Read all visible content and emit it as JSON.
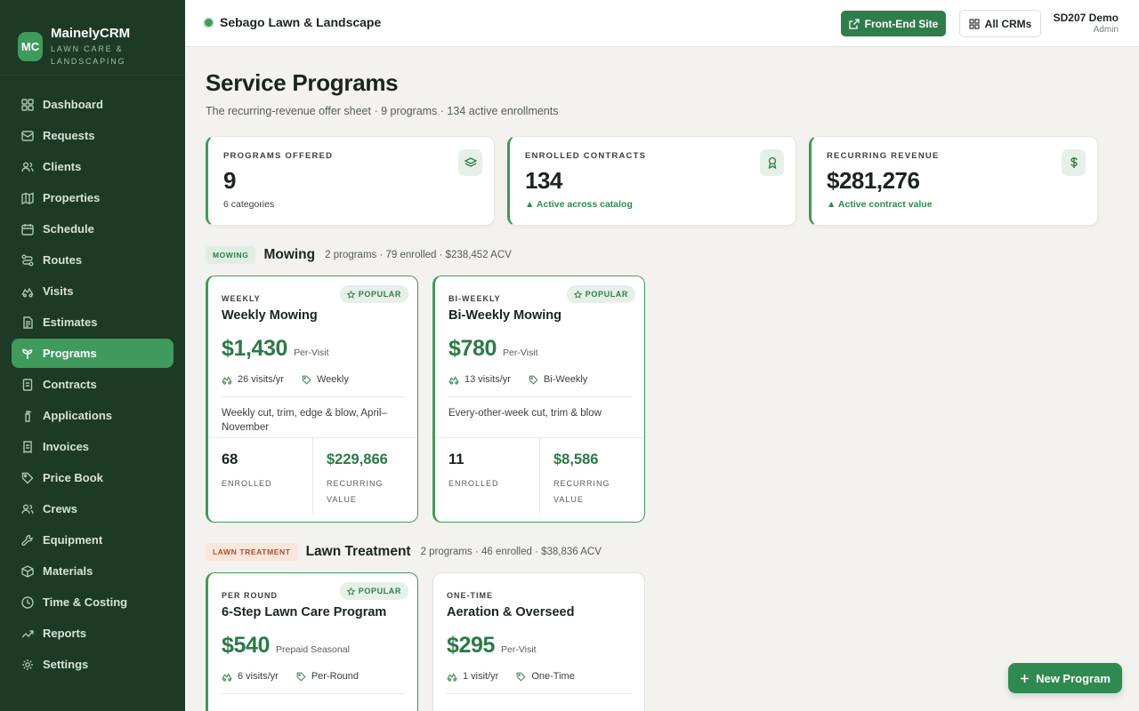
{
  "brand": {
    "logo": "MC",
    "name": "MainelyCRM",
    "subtitle": "LAWN CARE & LANDSCAPING"
  },
  "sidebar": {
    "items": [
      {
        "label": "Dashboard",
        "icon": "grid-icon"
      },
      {
        "label": "Requests",
        "icon": "inbox-icon"
      },
      {
        "label": "Clients",
        "icon": "users-icon"
      },
      {
        "label": "Properties",
        "icon": "map-icon"
      },
      {
        "label": "Schedule",
        "icon": "calendar-icon"
      },
      {
        "label": "Routes",
        "icon": "route-icon"
      },
      {
        "label": "Visits",
        "icon": "truck-icon"
      },
      {
        "label": "Estimates",
        "icon": "document-icon"
      },
      {
        "label": "Programs",
        "icon": "sprout-icon",
        "active": true
      },
      {
        "label": "Contracts",
        "icon": "contract-icon"
      },
      {
        "label": "Applications",
        "icon": "sprayer-icon"
      },
      {
        "label": "Invoices",
        "icon": "invoice-icon"
      },
      {
        "label": "Price Book",
        "icon": "tag-icon"
      },
      {
        "label": "Crews",
        "icon": "crew-icon"
      },
      {
        "label": "Equipment",
        "icon": "wrench-icon"
      },
      {
        "label": "Materials",
        "icon": "box-icon"
      },
      {
        "label": "Time & Costing",
        "icon": "clock-icon"
      },
      {
        "label": "Reports",
        "icon": "trend-icon"
      },
      {
        "label": "Settings",
        "icon": "gear-icon"
      }
    ]
  },
  "topbar": {
    "org_name": "Sebago Lawn & Landscape",
    "front_end_label": "Front-End Site",
    "all_crms_label": "All CRMs",
    "user_name": "SD207 Demo",
    "user_role": "Admin"
  },
  "page": {
    "title": "Service Programs",
    "subtitle": "The recurring-revenue offer sheet · 9 programs · 134 active enrollments"
  },
  "stats": [
    {
      "label": "PROGRAMS OFFERED",
      "value": "9",
      "note": "6 categories",
      "icon": "layers-icon"
    },
    {
      "label": "ENROLLED CONTRACTS",
      "value": "134",
      "note": "▲ Active across catalog",
      "icon": "award-icon"
    },
    {
      "label": "RECURRING REVENUE",
      "value": "$281,276",
      "note": "▲ Active contract value",
      "icon": "dollar-icon"
    }
  ],
  "sections": [
    {
      "tag": "MOWING",
      "title": "Mowing",
      "meta": "2 programs · 79 enrolled · $238,452 ACV",
      "cards": [
        {
          "kicker": "WEEKLY",
          "title": "Weekly Mowing",
          "badge": "POPULAR",
          "price": "$1,430",
          "unit": "Per-Visit",
          "visits": "26 visits/yr",
          "freq": "Weekly",
          "desc": "Weekly cut, trim, edge & blow, April–November",
          "enrolled": "68",
          "enrolled_label": "ENROLLED",
          "value": "$229,866",
          "value_label": "RECURRING VALUE"
        },
        {
          "kicker": "BI-WEEKLY",
          "title": "Bi-Weekly Mowing",
          "badge": "POPULAR",
          "price": "$780",
          "unit": "Per-Visit",
          "visits": "13 visits/yr",
          "freq": "Bi-Weekly",
          "desc": "Every-other-week cut, trim & blow",
          "enrolled": "11",
          "enrolled_label": "ENROLLED",
          "value": "$8,586",
          "value_label": "RECURRING VALUE"
        }
      ]
    },
    {
      "tag": "LAWN TREATMENT",
      "title": "Lawn Treatment",
      "meta": "2 programs · 46 enrolled · $38,836 ACV",
      "cards": [
        {
          "kicker": "PER ROUND",
          "title": "6-Step Lawn Care Program",
          "badge": "POPULAR",
          "price": "$540",
          "unit": "Prepaid Seasonal",
          "visits": "6 visits/yr",
          "freq": "Per-Round"
        },
        {
          "kicker": "ONE-TIME",
          "title": "Aeration & Overseed",
          "price": "$295",
          "unit": "Per-Visit",
          "visits": "1 visit/yr",
          "freq": "One-Time"
        }
      ]
    }
  ],
  "fab": {
    "label": "New Program"
  },
  "colors": {
    "sidebar": "#1d3a26",
    "accent": "#3f9a5c",
    "accent_dark": "#2f7d4a",
    "page_bg": "#f3f2ee"
  }
}
